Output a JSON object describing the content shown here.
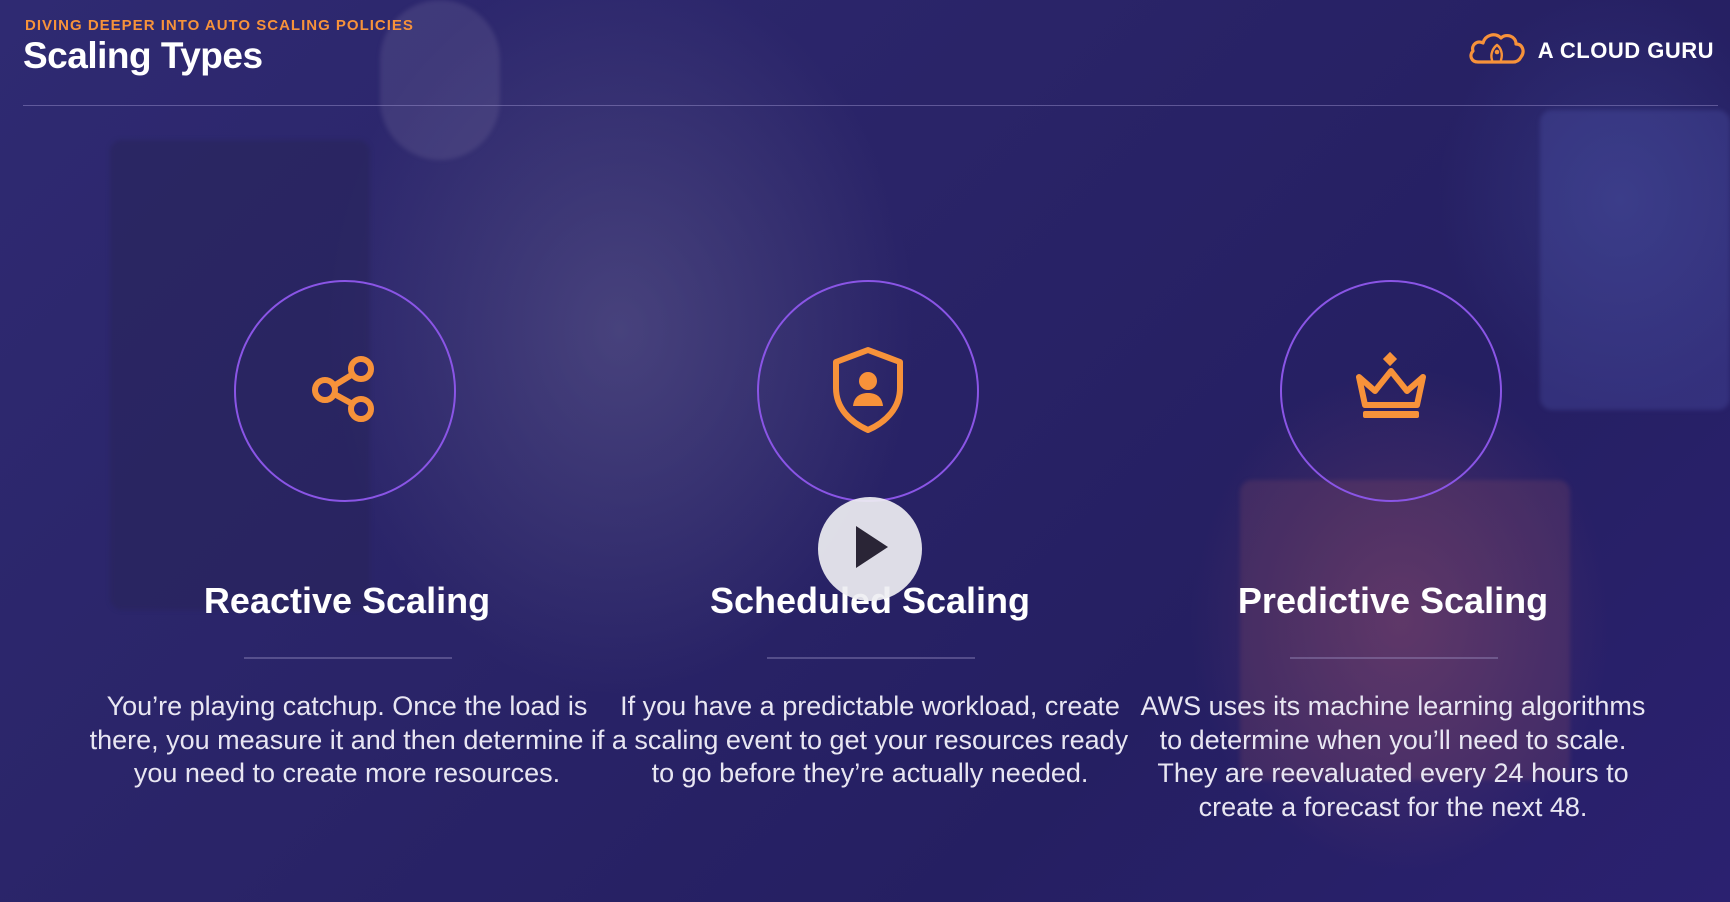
{
  "header": {
    "eyebrow": "DIVING DEEPER INTO AUTO SCALING POLICIES",
    "title": "Scaling Types"
  },
  "brand": {
    "name": "A CLOUD GURU",
    "icon": "cloud-logo-icon"
  },
  "cards": [
    {
      "icon": "share-icon",
      "title": "Reactive Scaling",
      "description": "You’re playing catchup. Once the load is there, you measure it and then determine if you need to create more resources."
    },
    {
      "icon": "shield-user-icon",
      "title": "Scheduled Scaling",
      "description": "If you have a predictable workload, create a scaling event to get your resources ready to go before they’re actually needed."
    },
    {
      "icon": "crown-icon",
      "title": "Predictive Scaling",
      "description": "AWS uses its machine learning algorithms to determine when you’ll need to scale. They are reevaluated every 24 hours to create a forecast for the next 48."
    }
  ],
  "player": {
    "icon": "play-icon"
  },
  "colors": {
    "accent": "#f7923a",
    "circle_border": "#8a55e6",
    "background": "#27226a"
  }
}
